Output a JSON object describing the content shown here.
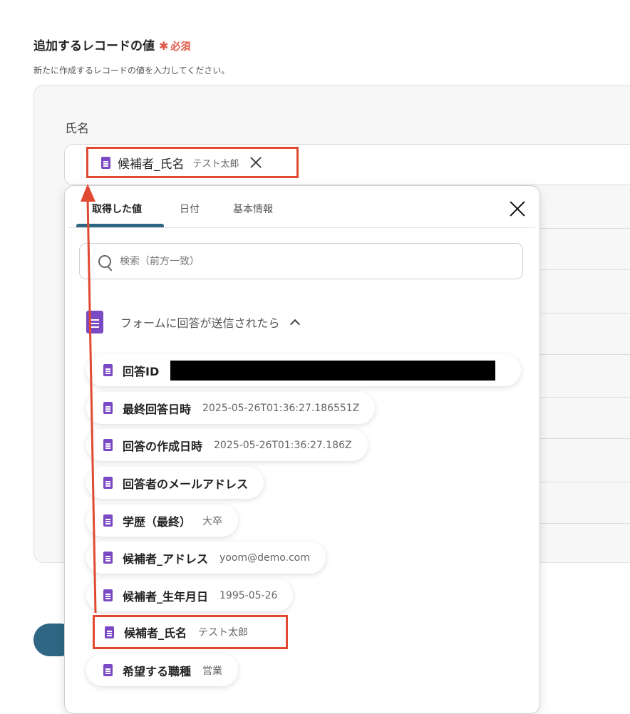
{
  "section": {
    "title": "追加するレコードの値",
    "required_mark": "✱",
    "required_label": "必須",
    "description": "新たに作成するレコードの値を入力してください。"
  },
  "field": {
    "label": "氏名",
    "chip": {
      "name": "候補者_氏名",
      "value": "テスト太郎"
    }
  },
  "popup": {
    "tabs": [
      {
        "label": "取得した値",
        "active": true
      },
      {
        "label": "日付",
        "active": false
      },
      {
        "label": "基本情報",
        "active": false
      }
    ],
    "search_placeholder": "検索（前方一致）",
    "group_label": "フォームに回答が送信されたら",
    "items": [
      {
        "name": "回答ID",
        "value": "",
        "redacted": true
      },
      {
        "name": "最終回答日時",
        "value": "2025-05-26T01:36:27.186551Z"
      },
      {
        "name": "回答の作成日時",
        "value": "2025-05-26T01:36:27.186Z"
      },
      {
        "name": "回答者のメールアドレス",
        "value": ""
      },
      {
        "name": "学歴（最終）",
        "value": "大卒"
      },
      {
        "name": "候補者_アドレス",
        "value": "yoom@demo.com"
      },
      {
        "name": "候補者_生年月日",
        "value": "1995-05-26"
      },
      {
        "name": "候補者_氏名",
        "value": "テスト太郎",
        "highlighted": true
      },
      {
        "name": "希望する職種",
        "value": "営業"
      }
    ]
  },
  "colors": {
    "accent": "#2f6683",
    "highlight": "#e04a33",
    "form_icon": "#7b49c4",
    "required": "#e05a4a"
  }
}
